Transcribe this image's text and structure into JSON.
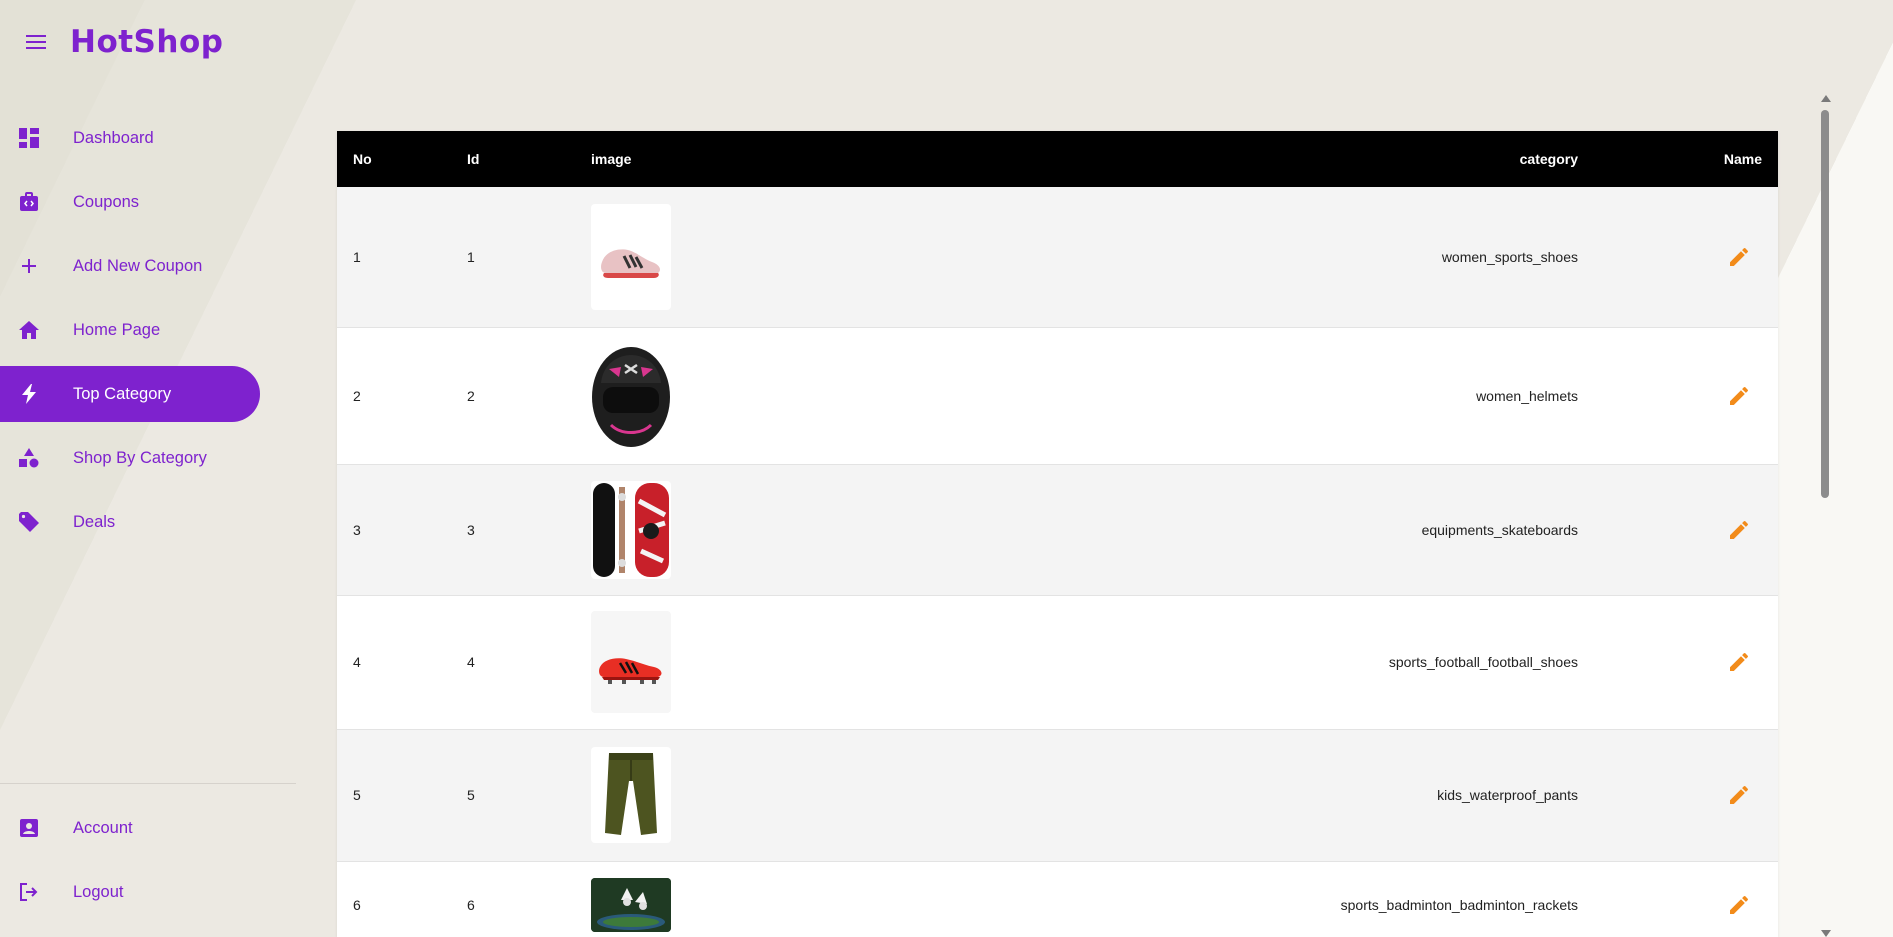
{
  "app": {
    "brand": "HotShop",
    "accent": "#7e22ce",
    "edit_color": "#f28b1a"
  },
  "sidebar": {
    "items": [
      {
        "label": "Dashboard",
        "icon": "dashboard-icon",
        "active": false
      },
      {
        "label": "Coupons",
        "icon": "coupon-icon",
        "active": false
      },
      {
        "label": "Add New Coupon",
        "icon": "plus-icon",
        "active": false
      },
      {
        "label": "Home Page",
        "icon": "home-icon",
        "active": false
      },
      {
        "label": "Top Category",
        "icon": "bolt-icon",
        "active": true
      },
      {
        "label": "Shop By Category",
        "icon": "category-shapes-icon",
        "active": false
      },
      {
        "label": "Deals",
        "icon": "tag-icon",
        "active": false
      }
    ],
    "bottom": [
      {
        "label": "Account",
        "icon": "account-box-icon"
      },
      {
        "label": "Logout",
        "icon": "logout-icon"
      }
    ]
  },
  "table": {
    "headers": {
      "no": "No",
      "id": "Id",
      "image": "image",
      "category": "category",
      "name": "Name"
    },
    "rows": [
      {
        "no": "1",
        "id": "1",
        "image": "sneaker-pink-icon",
        "category": "women_sports_shoes"
      },
      {
        "no": "2",
        "id": "2",
        "image": "helmet-icon",
        "category": "women_helmets"
      },
      {
        "no": "3",
        "id": "3",
        "image": "skateboard-icon",
        "category": "equipments_skateboards"
      },
      {
        "no": "4",
        "id": "4",
        "image": "football-shoe-icon",
        "category": "sports_football_football_shoes"
      },
      {
        "no": "5",
        "id": "5",
        "image": "pants-icon",
        "category": "kids_waterproof_pants"
      },
      {
        "no": "6",
        "id": "6",
        "image": "badminton-icon",
        "category": "sports_badminton_badminton_rackets"
      }
    ]
  }
}
